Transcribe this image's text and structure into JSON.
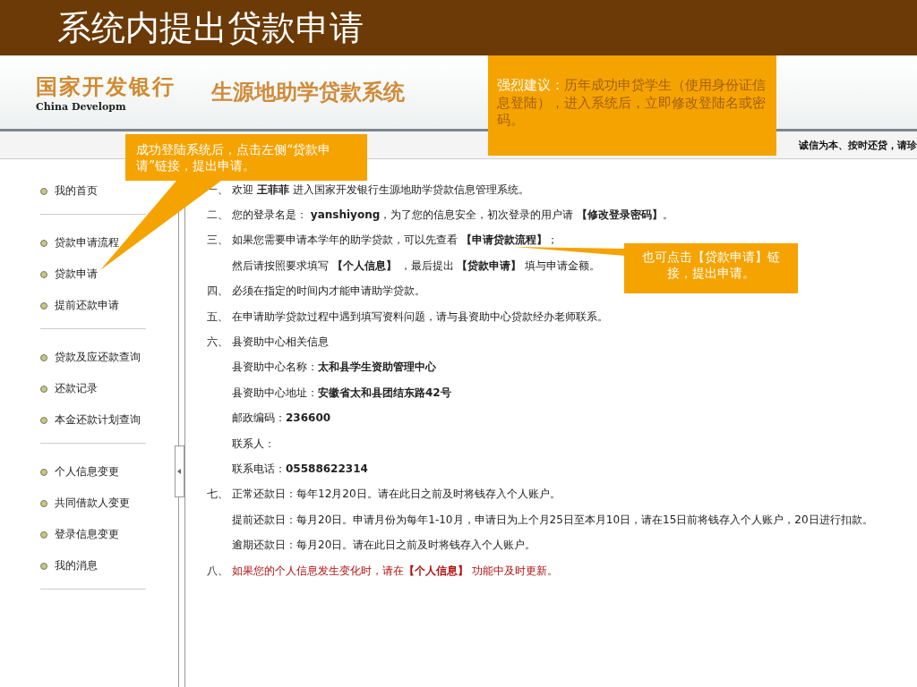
{
  "slide_title": "系统内提出贷款申请",
  "header": {
    "bank_name": "国家开发银行",
    "bank_name_en": "China Developm",
    "system_name": "生源地助学贷款系统",
    "slogan": "诚信为本、按时还贷，请珍"
  },
  "sidebar": {
    "groups": [
      {
        "items": [
          "我的首页"
        ]
      },
      {
        "items": [
          "贷款申请流程",
          "贷款申请",
          "提前还款申请"
        ]
      },
      {
        "items": [
          "贷款及应还款查询",
          "还款记录",
          "本金还款计划查询"
        ]
      },
      {
        "items": [
          "个人信息变更",
          "共同借款人变更",
          "登录信息变更",
          "我的消息"
        ]
      }
    ]
  },
  "content": [
    {
      "number": "一、",
      "text": "欢迎 **王菲菲** 进入国家开发银行生源地助学贷款信息管理系统。",
      "kind": "normal"
    },
    {
      "number": "二、",
      "text": "您的登录名是： **yanshiyong**，为了您的信息安全，初次登录的用户请 **【修改登录密码】**。",
      "kind": "normal"
    },
    {
      "number": "三、",
      "text": "如果您需要申请本学年的助学贷款，可以先查看 **【申请贷款流程】**；",
      "kind": "normal"
    },
    {
      "text": "然后请按照要求填写 **【个人信息】** ，最后提出 **【贷款申请】** 填与申请金额。",
      "kind": "normal"
    },
    {
      "number": "四、",
      "text": "必须在指定的时间内才能申请助学贷款。",
      "kind": "normal"
    },
    {
      "number": "五、",
      "text": "在申请助学贷款过程中遇到填写资料问题，请与县资助中心贷款经办老师联系。",
      "kind": "normal"
    },
    {
      "number": "六、",
      "text": "县资助中心相关信息",
      "kind": "normal"
    },
    {
      "text": "县资助中心名称：**太和县学生资助管理中心**",
      "kind": "normal"
    },
    {
      "text": "县资助中心地址：**安徽省太和县团结东路42号**",
      "kind": "normal"
    },
    {
      "text": "邮政编码：**236600**",
      "kind": "normal"
    },
    {
      "text": "联系人：",
      "kind": "normal"
    },
    {
      "text": "联系电话：**05588622314**",
      "kind": "normal"
    },
    {
      "number": "七、",
      "text": "正常还款日：每年12月20日。请在此日之前及时将钱存入个人账户。",
      "kind": "normal"
    },
    {
      "text": "提前还款日：每月20日。申请月份为每年1-10月，申请日为上个月25日至本月10日，请在15日前将钱存入个人账户，20日进行扣款。",
      "kind": "normal"
    },
    {
      "text": "逾期还款日：每月20日。请在此日之前及时将钱存入个人账户。",
      "kind": "normal"
    },
    {
      "number": "八、",
      "text": "如果您的个人信息发生变化时，请在**【个人信息】** 功能中及时更新。",
      "kind": "alert"
    }
  ],
  "callouts": [
    {
      "text": "成功登陆系统后，点击左侧“贷款申请”链接，提出申请。",
      "kind": "left"
    },
    {
      "lead": "强烈建议：",
      "text": "历年成功申贷学生（使用身份证信息登陆），进入系统后，立即修改登陆名或密码。",
      "kind": "top"
    },
    {
      "text": "也可点击【贷款申请】链接，提出申请。",
      "kind": "right"
    }
  ]
}
